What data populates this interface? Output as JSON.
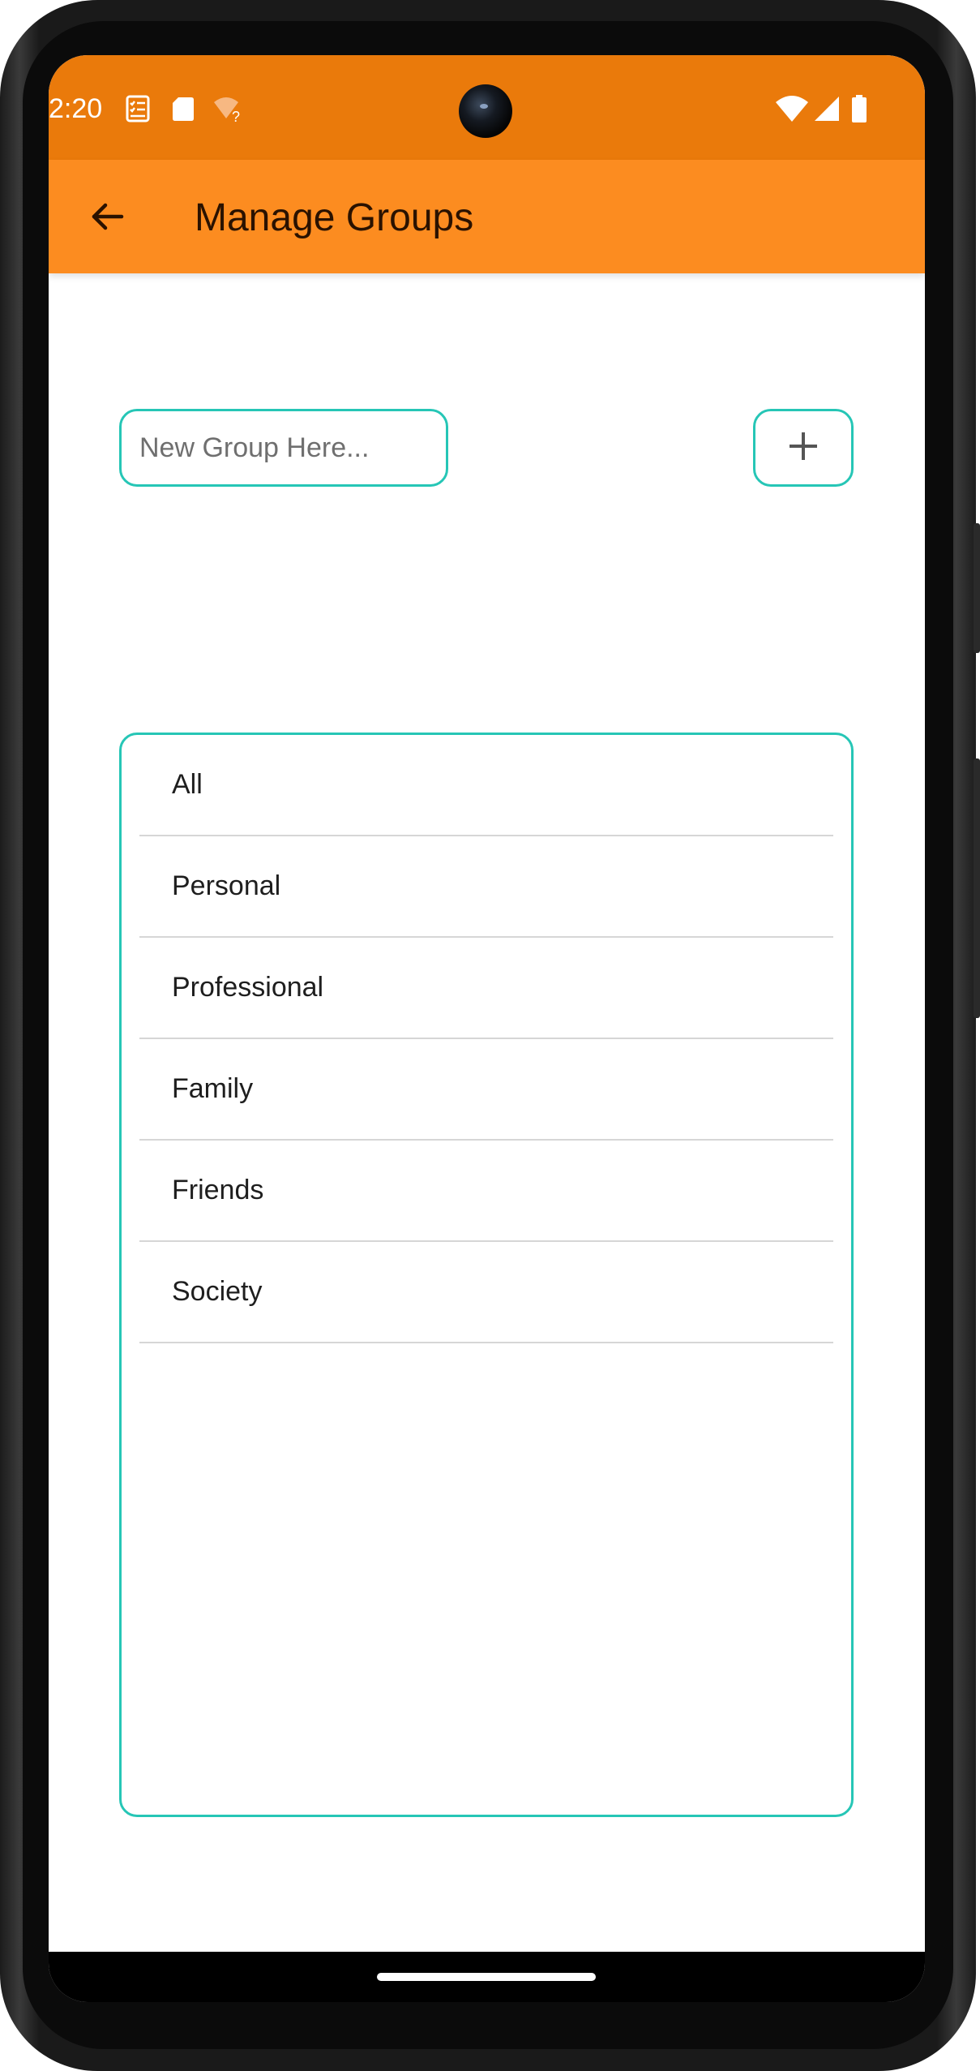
{
  "status_bar": {
    "time": "2:20",
    "left_icons": [
      "checklist-notification-icon",
      "sd-card-icon",
      "wifi-question-icon"
    ],
    "right_icons": [
      "wifi-icon",
      "signal-icon",
      "battery-icon"
    ]
  },
  "app_bar": {
    "title": "Manage Groups",
    "back_icon": "arrow-back-icon",
    "background": "#fc8c20"
  },
  "new_group": {
    "placeholder": "New Group Here...",
    "value": "",
    "add_icon": "plus-icon"
  },
  "groups": [
    {
      "label": "All"
    },
    {
      "label": "Personal"
    },
    {
      "label": "Professional"
    },
    {
      "label": "Family"
    },
    {
      "label": "Friends"
    },
    {
      "label": "Society"
    }
  ],
  "colors": {
    "status_bar": "#ea7a0b",
    "app_bar": "#fc8c20",
    "accent_border": "#26c6b6"
  }
}
